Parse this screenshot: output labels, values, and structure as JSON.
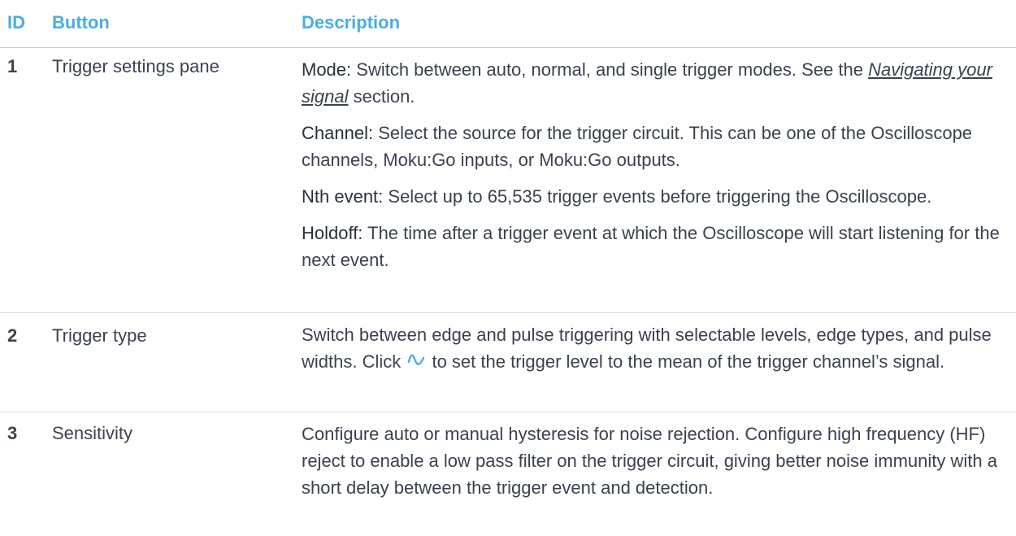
{
  "header": {
    "id": "ID",
    "button": "Button",
    "description": "Description"
  },
  "rows": [
    {
      "id": "1",
      "button": "Trigger settings pane",
      "items": [
        {
          "term": "Mode:",
          "text_before_link": " Switch between auto, normal, and single trigger modes. See the ",
          "link": "Navigating your signal",
          "text_after_link": " section."
        },
        {
          "term": "Channel:",
          "text": " Select the source for the trigger circuit. This can be one of the Oscilloscope channels, Moku:Go inputs, or Moku:Go outputs."
        },
        {
          "term": "Nth event:",
          "text": " Select up to 65,535 trigger events before triggering the Oscilloscope."
        },
        {
          "term": "Holdoff:",
          "text": " The time after a trigger event at which the Oscilloscope will start listening for the next event."
        }
      ]
    },
    {
      "id": "2",
      "button": "Trigger type",
      "text_before_icon": "Switch between edge and pulse triggering with selectable levels, edge types, and pulse widths. Click ",
      "icon": "trigger-level-wave-icon",
      "text_after_icon": " to set the trigger level to the mean of the trigger channel’s signal."
    },
    {
      "id": "3",
      "button": "Sensitivity",
      "text": "Configure auto or manual hysteresis for noise rejection. Configure high frequency (HF) reject to enable a low pass filter on the trigger circuit, giving better noise immunity with a short delay between the trigger event and detection."
    }
  ],
  "colors": {
    "header": "#4aaee0",
    "text": "#3a4250",
    "icon": "#4aaee0",
    "rule": "#d3d6da"
  }
}
